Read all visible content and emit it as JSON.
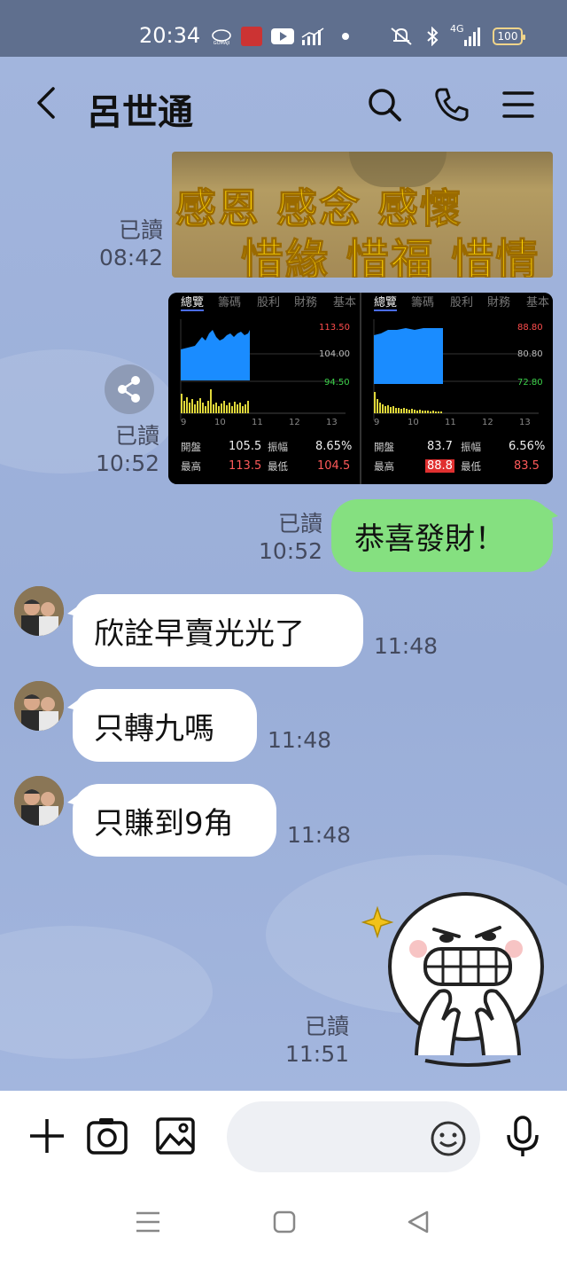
{
  "status_bar": {
    "time": "20:34",
    "battery": "100",
    "network": "4G",
    "icons": [
      "gomaji-icon",
      "app-icon",
      "youtube-icon",
      "signal-chart-icon",
      "dot-icon",
      "mute-icon",
      "bluetooth-icon",
      "cellular-signal-icon",
      "battery-icon"
    ]
  },
  "header": {
    "title": "呂世通",
    "icons": [
      "back-icon",
      "search-icon",
      "phone-icon",
      "menu-icon"
    ]
  },
  "messages": {
    "img1": {
      "read": "已讀",
      "time": "08:42",
      "line1": "感恩  感念  感懷",
      "line2": "惜緣  惜福  惜情"
    },
    "img2": {
      "read": "已讀",
      "time": "10:52",
      "left_panel": {
        "tabs": [
          "總覽",
          "籌碼",
          "股利",
          "財務",
          "基本"
        ],
        "price_high": "113.50",
        "price_mid": "104.00",
        "price_low": "94.50",
        "x_ticks": [
          "9",
          "10",
          "11",
          "12",
          "13"
        ],
        "rows": [
          {
            "k1": "開盤",
            "v1": "105.5",
            "k2": "振幅",
            "v2": "8.65%"
          },
          {
            "k1": "最高",
            "v1": "113.5",
            "k2": "最低",
            "v2": "104.5"
          },
          {
            "k1": "",
            "v1": "",
            "k2": "",
            "v2": ""
          }
        ]
      },
      "right_panel": {
        "tabs": [
          "總覽",
          "籌碼",
          "股利",
          "財務",
          "基本"
        ],
        "price_high": "88.80",
        "price_mid": "80.80",
        "price_low": "72.80",
        "x_ticks": [
          "9",
          "10",
          "11",
          "12",
          "13"
        ],
        "rows": [
          {
            "k1": "開盤",
            "v1": "83.7",
            "k2": "振幅",
            "v2": "6.56%"
          },
          {
            "k1": "最高",
            "v1": "88.8",
            "k2": "最低",
            "v2": "83.5"
          },
          {
            "k1": "",
            "v1": "",
            "k2": "",
            "v2": ""
          }
        ]
      }
    },
    "m1": {
      "read": "已讀",
      "time": "10:52",
      "text": "恭喜發財！"
    },
    "m2": {
      "text": "欣詮早賣光光了",
      "time": "11:48"
    },
    "m3": {
      "text": "只轉九嗎",
      "time": "11:48"
    },
    "m4": {
      "text": "只賺到9角",
      "time": "11:48"
    },
    "sticker": {
      "read": "已讀",
      "time": "11:51"
    }
  },
  "input_bar": {
    "icons": [
      "plus-icon",
      "camera-icon",
      "image-icon",
      "emoji-icon",
      "mic-icon"
    ],
    "placeholder": ""
  },
  "nav_bar": {
    "icons": [
      "recents-icon",
      "home-icon",
      "back-nav-icon"
    ]
  },
  "colors": {
    "my_bubble": "#85e080",
    "chat_bg": "#9cb0d8",
    "status_bar": "#5f6f8e",
    "chart_blue": "#1a8cff",
    "chart_yellow": "#e0d83a"
  }
}
